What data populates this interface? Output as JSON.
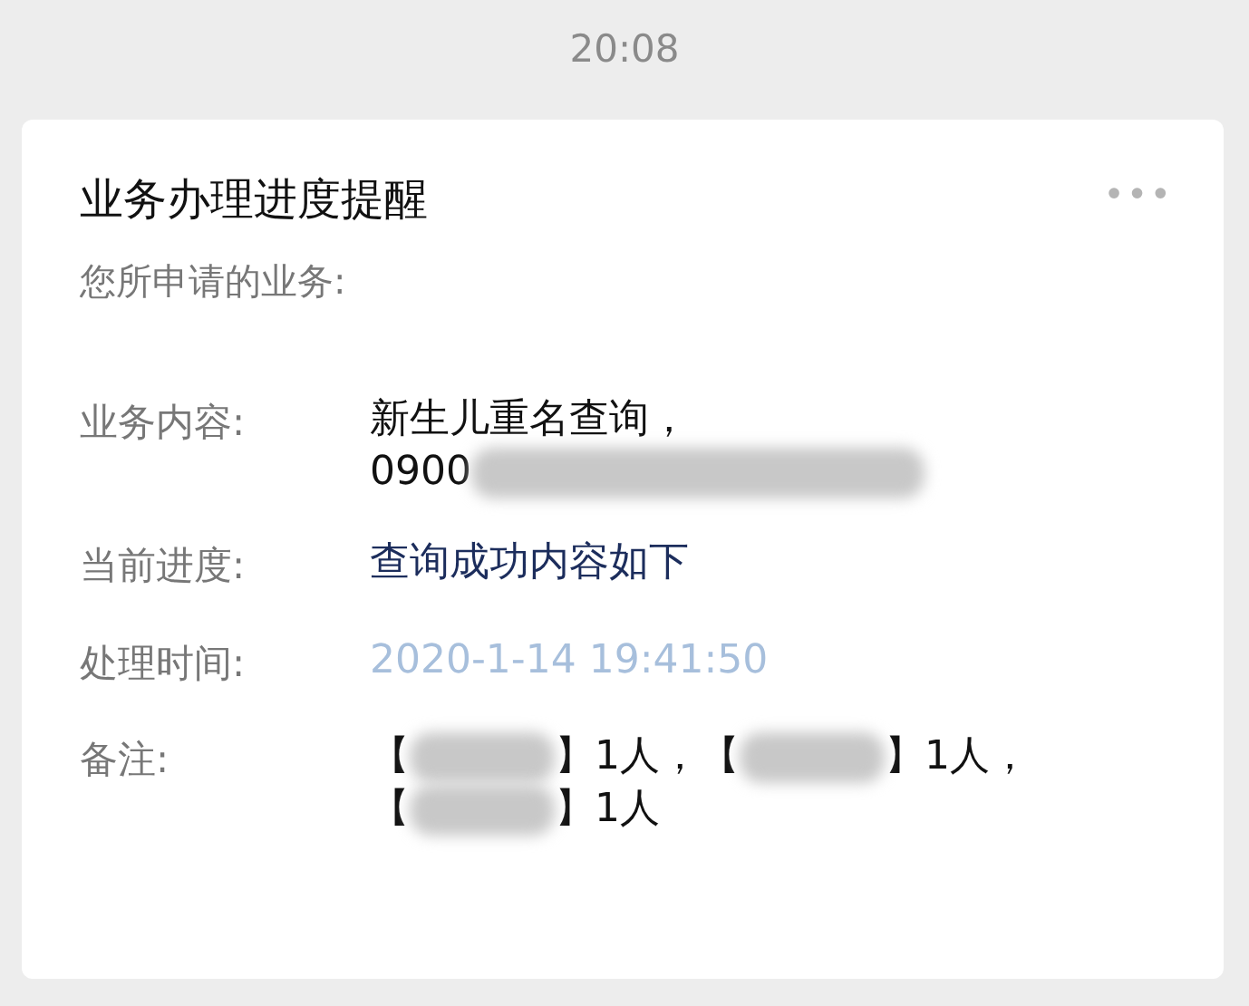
{
  "time": "20:08",
  "card": {
    "title": "业务办理进度提醒",
    "more": "•••",
    "subtitle": "您所申请的业务:",
    "fields": [
      {
        "label": "业务内容:",
        "color": "#111111",
        "parts": [
          {
            "kind": "text",
            "text": "新生儿重名查询，"
          },
          {
            "kind": "break"
          },
          {
            "kind": "text",
            "text": "0900"
          },
          {
            "kind": "redacted_long"
          }
        ]
      },
      {
        "label": "当前进度:",
        "color": "#1c2d5c",
        "parts": [
          {
            "kind": "text",
            "text": "查询成功内容如下"
          }
        ]
      },
      {
        "label": "处理时间:",
        "color": "#a7bfdc",
        "parts": [
          {
            "kind": "text",
            "text": "2020-1-14 19:41:50"
          }
        ]
      },
      {
        "label": "备注:",
        "color": "#111111",
        "parts": [
          {
            "kind": "text",
            "text": "【"
          },
          {
            "kind": "redacted_short"
          },
          {
            "kind": "text",
            "text": "】1人，"
          },
          {
            "kind": "text",
            "text": "【"
          },
          {
            "kind": "redacted_short"
          },
          {
            "kind": "text",
            "text": "】1人，"
          },
          {
            "kind": "break"
          },
          {
            "kind": "text",
            "text": "【"
          },
          {
            "kind": "redacted_short"
          },
          {
            "kind": "text",
            "text": "】1人"
          }
        ]
      }
    ]
  }
}
